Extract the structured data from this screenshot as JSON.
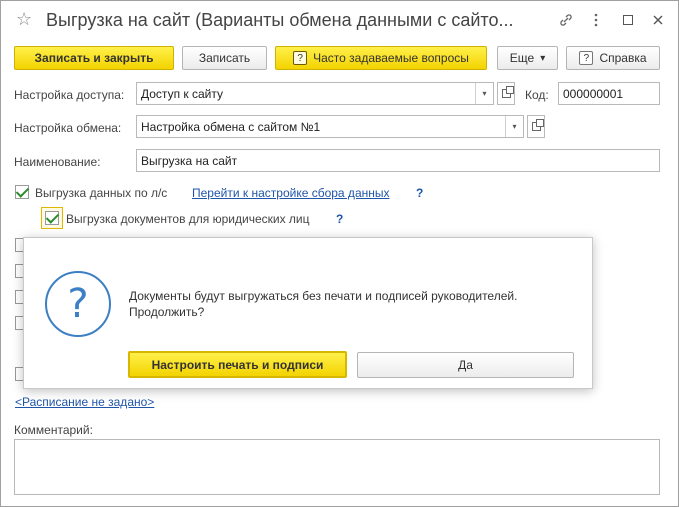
{
  "window": {
    "title": "Выгрузка на сайт (Варианты обмена данными с сайто...",
    "controls": [
      "link-icon",
      "more-icon",
      "maximize-icon",
      "close-icon"
    ]
  },
  "toolbar": {
    "save_close": "Записать и закрыть",
    "save": "Записать",
    "faq_badge": "?",
    "faq": "Часто задаваемые вопросы",
    "more": "Еще",
    "more_arrow": "▾",
    "help_badge": "?",
    "help": "Справка"
  },
  "form": {
    "access_label": "Настройка доступа:",
    "access_value": "Доступ к сайту",
    "code_label": "Код:",
    "code_value": "000000001",
    "exchange_label": "Настройка обмена:",
    "exchange_value": "Настройка обмена с сайтом №1",
    "name_label": "Наименование:",
    "name_value": "Выгрузка на сайт",
    "export_ls_label": "Выгрузка данных по л/с",
    "export_ls_checked": true,
    "goto_link": "Перейти к настройке сбора данных",
    "help_mark": "?",
    "export_docs_label": "Выгрузка документов для юридических лиц",
    "export_docs_checked": true,
    "help_mark2": "?",
    "schedule_link": "<Расписание не задано>",
    "comment_label": "Комментарий:",
    "comment_value": ""
  },
  "dialog": {
    "icon": "question-icon",
    "icon_glyph": "?",
    "message": "Документы будут выгружаться без печати и подписей руководителей. Продолжить?",
    "primary_button": "Настроить печать и подписи",
    "secondary_button": "Да"
  },
  "colors": {
    "accent_yellow": "#f3d300",
    "link_blue": "#1f55a8",
    "check_green": "#2e8b2e",
    "dialog_icon_blue": "#3d7fc4"
  }
}
